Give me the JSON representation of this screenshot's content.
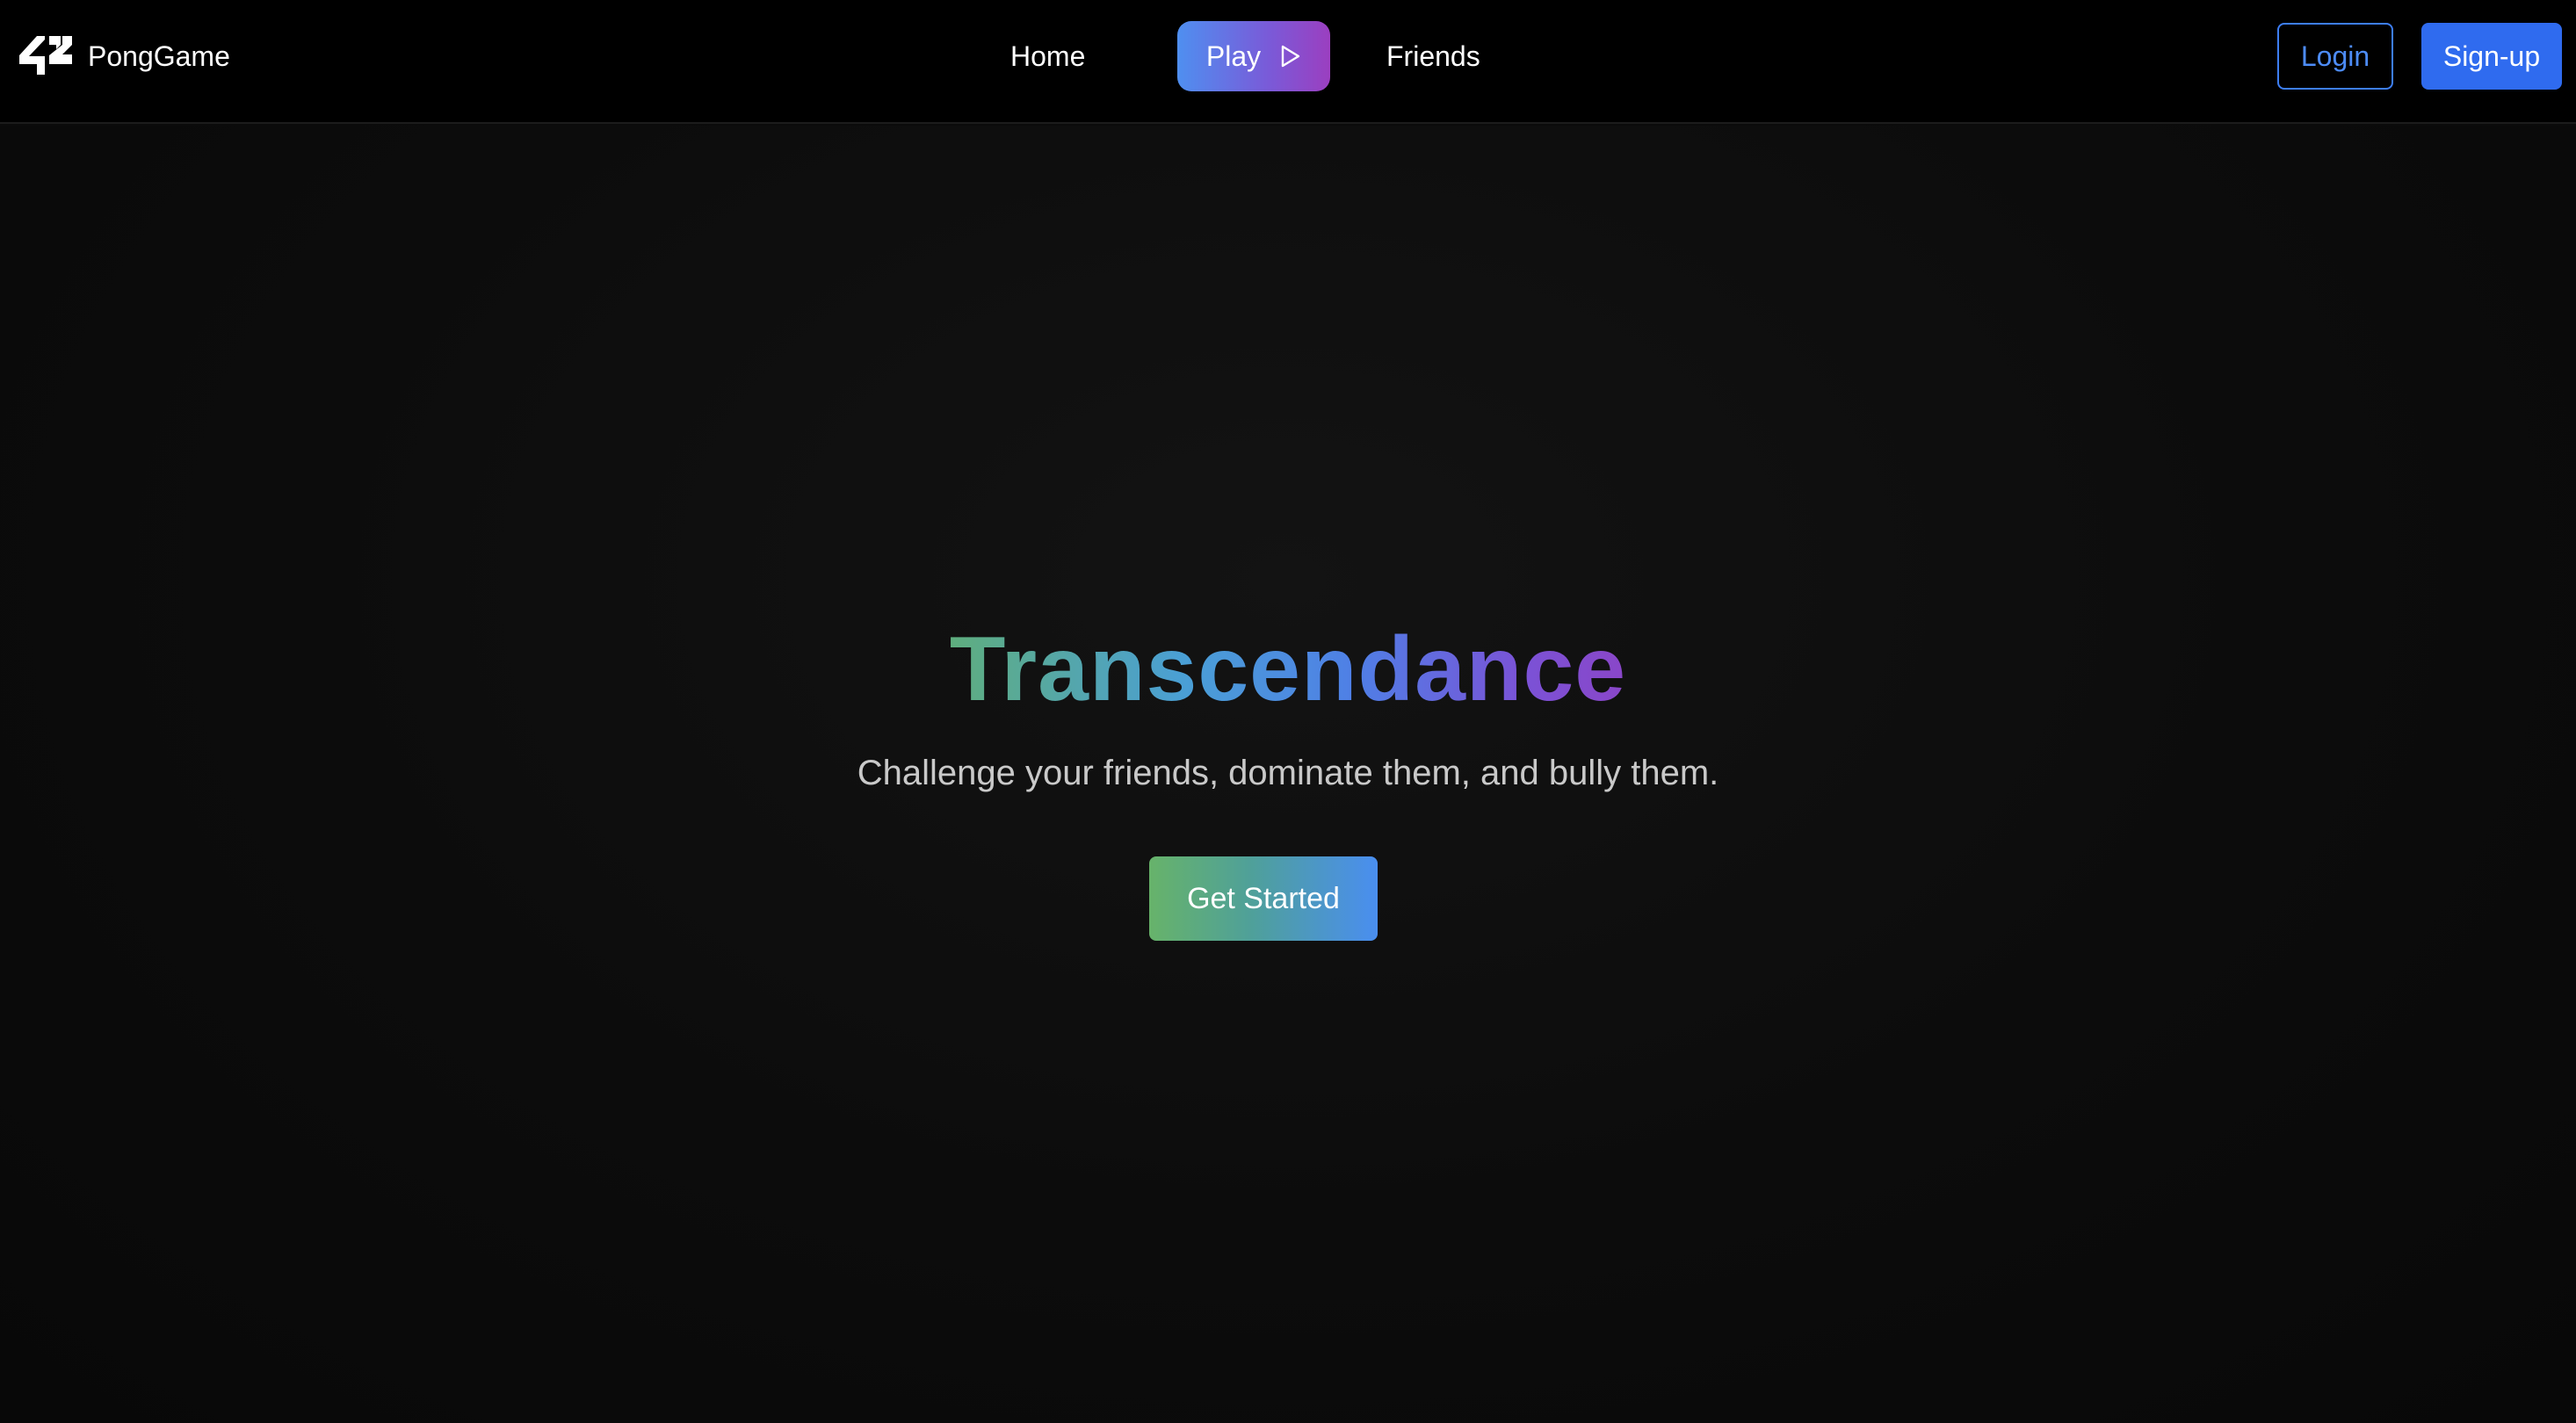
{
  "navbar": {
    "brand": {
      "logo_icon": "42-logo-icon",
      "name": "PongGame"
    },
    "links": {
      "home": "Home",
      "play": "Play",
      "play_icon": "play-triangle-icon",
      "friends": "Friends"
    },
    "auth": {
      "login": "Login",
      "signup": "Sign-up"
    }
  },
  "hero": {
    "title": "Transcendance",
    "subtitle": "Challenge your friends, dominate them, and bully them.",
    "cta": "Get Started"
  },
  "colors": {
    "background": "#0b0b0b",
    "navbar": "#000000",
    "accent_blue": "#2f6bef",
    "login_border": "#3d7ef5",
    "play_gradient": [
      "#4f8ff0",
      "#9b3fc0"
    ],
    "title_gradient": [
      "#5fae7e",
      "#4a9fd6",
      "#7b52d6"
    ],
    "cta_gradient": [
      "#67b36a",
      "#4a8ef0"
    ],
    "subtitle": "#c9c9c9"
  }
}
